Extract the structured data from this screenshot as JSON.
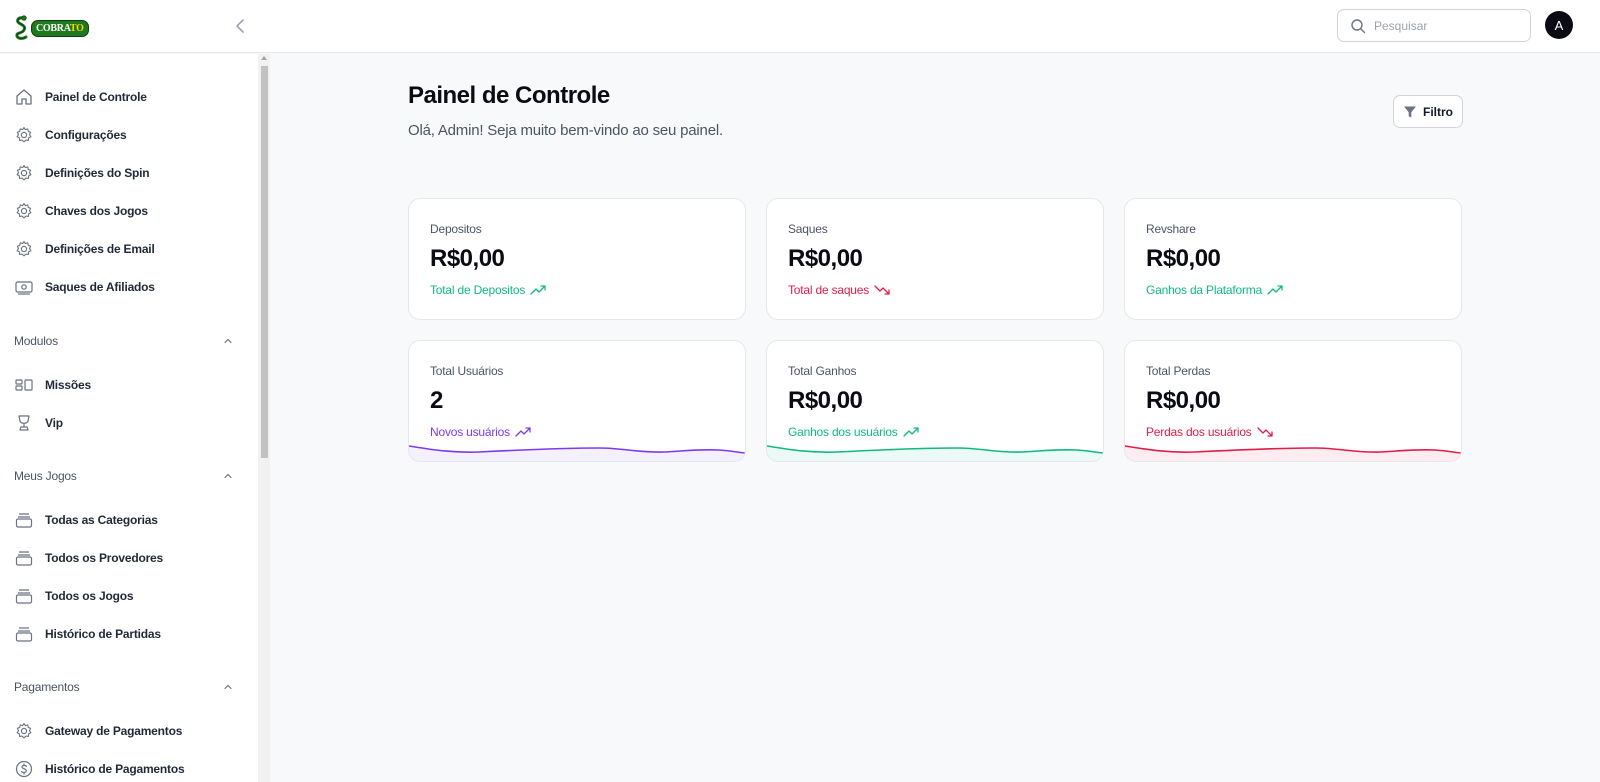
{
  "header": {
    "logo": {
      "text": "COBRA",
      "suffix": "TO",
      "icon": "snake-icon"
    },
    "search_placeholder": "Pesquisar",
    "avatar_initial": "A"
  },
  "sidebar": {
    "items": [
      {
        "label": "Painel de Controle",
        "icon": "home-icon"
      },
      {
        "label": "Configurações",
        "icon": "gear-icon"
      },
      {
        "label": "Definições do Spin",
        "icon": "gear-icon"
      },
      {
        "label": "Chaves dos Jogos",
        "icon": "gear-icon"
      },
      {
        "label": "Definições de Email",
        "icon": "gear-icon"
      },
      {
        "label": "Saques de Afiliados",
        "icon": "banknote-icon"
      }
    ],
    "sections": [
      {
        "title": "Modulos",
        "items": [
          {
            "label": "Missões",
            "icon": "layout-icon"
          },
          {
            "label": "Vip",
            "icon": "trophy-icon"
          }
        ]
      },
      {
        "title": "Meus Jogos",
        "items": [
          {
            "label": "Todas as Categorias",
            "icon": "archive-icon"
          },
          {
            "label": "Todos os Provedores",
            "icon": "archive-icon"
          },
          {
            "label": "Todos os Jogos",
            "icon": "archive-icon"
          },
          {
            "label": "Histórico de Partidas",
            "icon": "archive-icon"
          }
        ]
      },
      {
        "title": "Pagamentos",
        "items": [
          {
            "label": "Gateway de Pagamentos",
            "icon": "gear-icon"
          },
          {
            "label": "Histórico de Pagamentos",
            "icon": "dollar-icon"
          }
        ]
      }
    ]
  },
  "main": {
    "title": "Painel de Controle",
    "subtitle": "Olá, Admin! Seja muito bem-vindo ao seu painel.",
    "filter_label": "Filtro",
    "cards": [
      {
        "label": "Depositos",
        "value": "R$0,00",
        "trend": "Total de Depositos",
        "direction": "up",
        "color": "#10b981"
      },
      {
        "label": "Saques",
        "value": "R$0,00",
        "trend": "Total de saques",
        "direction": "down",
        "color": "#e11d48"
      },
      {
        "label": "Revshare",
        "value": "R$0,00",
        "trend": "Ganhos da Plataforma",
        "direction": "up",
        "color": "#10b981"
      },
      {
        "label": "Total Usuários",
        "value": "2",
        "trend": "Novos usuários",
        "direction": "up",
        "color": "#7c3aed"
      },
      {
        "label": "Total Ganhos",
        "value": "R$0,00",
        "trend": "Ganhos dos usuários",
        "direction": "up",
        "color": "#10b981"
      },
      {
        "label": "Total Perdas",
        "value": "R$0,00",
        "trend": "Perdas dos usuários",
        "direction": "down",
        "color": "#e11d48"
      }
    ]
  }
}
